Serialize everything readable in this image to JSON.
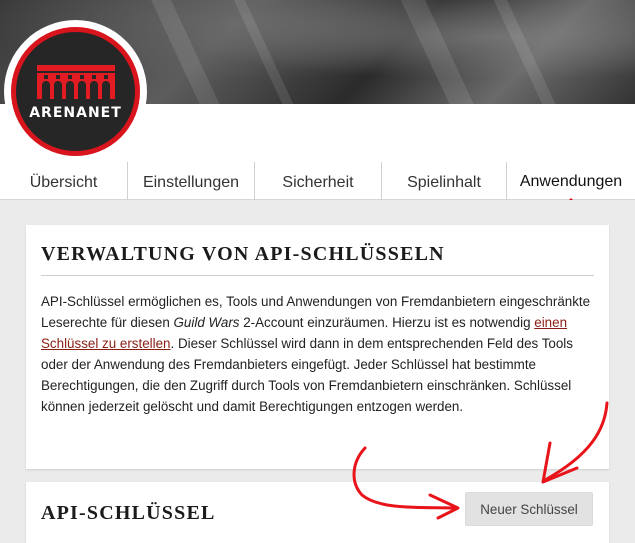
{
  "brand": {
    "logo_text": "ARENANET"
  },
  "tabs": [
    {
      "label": "Übersicht",
      "active": false
    },
    {
      "label": "Einstellungen",
      "active": false
    },
    {
      "label": "Sicherheit",
      "active": false
    },
    {
      "label": "Spielinhalt",
      "active": false
    },
    {
      "label": "Anwendungen",
      "active": true
    }
  ],
  "management": {
    "title": "VERWALTUNG VON API-SCHLÜSSELN",
    "p1": "API-Schlüssel ermöglichen es, Tools und Anwendungen von Fremdanbietern eingeschränkte Leserechte für diesen ",
    "p_game": "Guild Wars",
    "p2": " 2-Account einzuräumen. Hierzu ist es notwendig ",
    "link": "einen Schlüssel zu erstellen",
    "p3": ". Dieser Schlüssel wird dann in dem entsprechenden Feld des Tools oder der Anwendung des Fremdanbieters eingefügt. Jeder Schlüssel hat bestimmte Berechtigungen, die den Zugriff durch Tools von Fremdanbietern einschränken. Schlüssel können jederzeit gelöscht und damit Berechtigungen entzogen werden."
  },
  "keys": {
    "title": "API-SCHLÜSSEL",
    "new_key_label": "Neuer Schlüssel"
  },
  "colors": {
    "accent": "#d8141d",
    "annotation": "#e8141a"
  }
}
